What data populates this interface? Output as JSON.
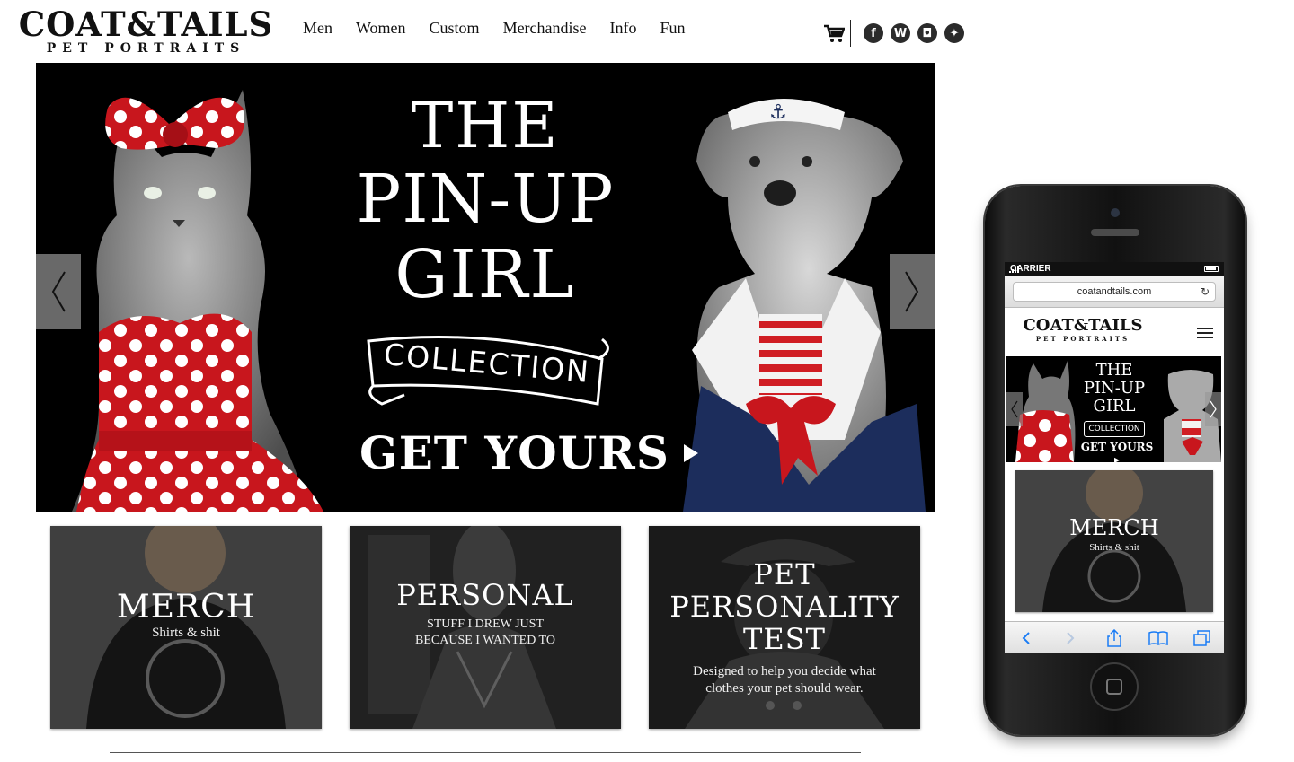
{
  "logo": {
    "main": "COAT&TAILS",
    "sub": "PET PORTRAITS"
  },
  "nav": {
    "items": [
      "Men",
      "Women",
      "Custom",
      "Merchandise",
      "Info",
      "Fun"
    ]
  },
  "social": {
    "icons": [
      "cart-icon",
      "facebook-icon",
      "wordpress-icon",
      "instagram-icon",
      "twitter-icon"
    ],
    "facebook_glyph": "f",
    "wordpress_glyph": "W",
    "instagram_glyph": "◘",
    "twitter_glyph": "✦"
  },
  "hero": {
    "title_line1": "THE",
    "title_line2": "PIN-UP",
    "title_line3": "GIRL",
    "banner": "COLLECTION",
    "cta": "GET YOURS"
  },
  "cards": [
    {
      "title": "MERCH",
      "subtitle": "Shirts & shit"
    },
    {
      "title": "PERSONAL",
      "subtitle_line1": "STUFF I DREW JUST",
      "subtitle_line2": "BECAUSE I WANTED TO"
    },
    {
      "title_line1": "PET",
      "title_line2": "PERSONALITY",
      "title_line3": "TEST",
      "subtitle_line1": "Designed to help you decide what",
      "subtitle_line2": "clothes your pet should wear."
    }
  ],
  "mobile": {
    "carrier": "CARRIER",
    "url": "coatandtails.com",
    "reload_glyph": "↻",
    "logo_main": "COAT&TAILS",
    "logo_sub": "PET PORTRAITS",
    "hero_line1": "THE",
    "hero_line2": "PIN-UP",
    "hero_line3": "GIRL",
    "hero_banner": "COLLECTION",
    "hero_cta": "GET YOURS ▸",
    "card_title": "MERCH",
    "card_subtitle": "Shirts & shit"
  },
  "colors": {
    "polka_red": "#c8161d",
    "navy": "#1c2d5c",
    "hero_bg": "#000000"
  }
}
